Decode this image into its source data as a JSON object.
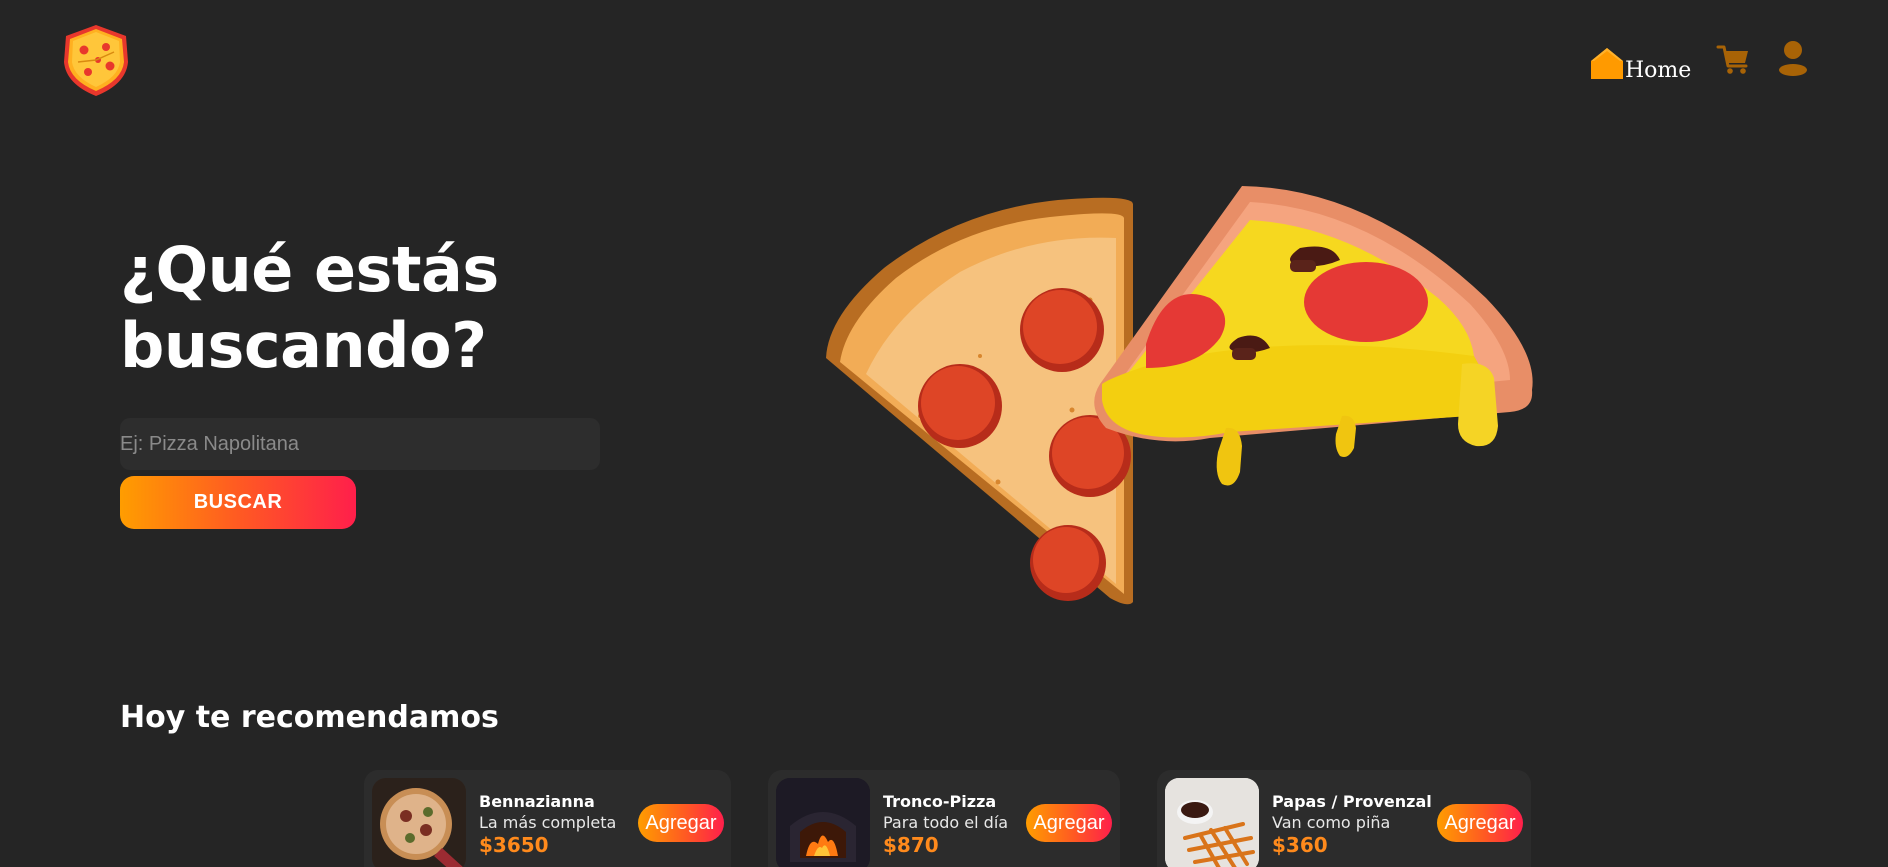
{
  "nav": {
    "home_label": "Home",
    "icons": {
      "brand": "pizza-shield-logo-icon",
      "home": "home-icon",
      "cart": "cart-icon",
      "user": "user-icon"
    }
  },
  "hero": {
    "title": "¿Qué estás\nbuscando?",
    "search_placeholder": "Ej: Pizza Napolitana",
    "search_button": "BUSCAR"
  },
  "recommendations": {
    "title": "Hoy te recomendamos",
    "items": [
      {
        "name": "Bennazianna",
        "description": "La más completa",
        "price": "$3650",
        "add_label": "Agregar"
      },
      {
        "name": "Tronco-Pizza",
        "description": "Para todo el día",
        "price": "$870",
        "add_label": "Agregar"
      },
      {
        "name": "Papas / Provenzal",
        "description": "Van como piña",
        "price": "$360",
        "add_label": "Agregar"
      }
    ]
  },
  "colors": {
    "background": "#252525",
    "accent_start": "#ff9d00",
    "accent_end": "#ff1f4b",
    "price": "#ff8a1c",
    "nav_icon": "#ff9a00"
  }
}
